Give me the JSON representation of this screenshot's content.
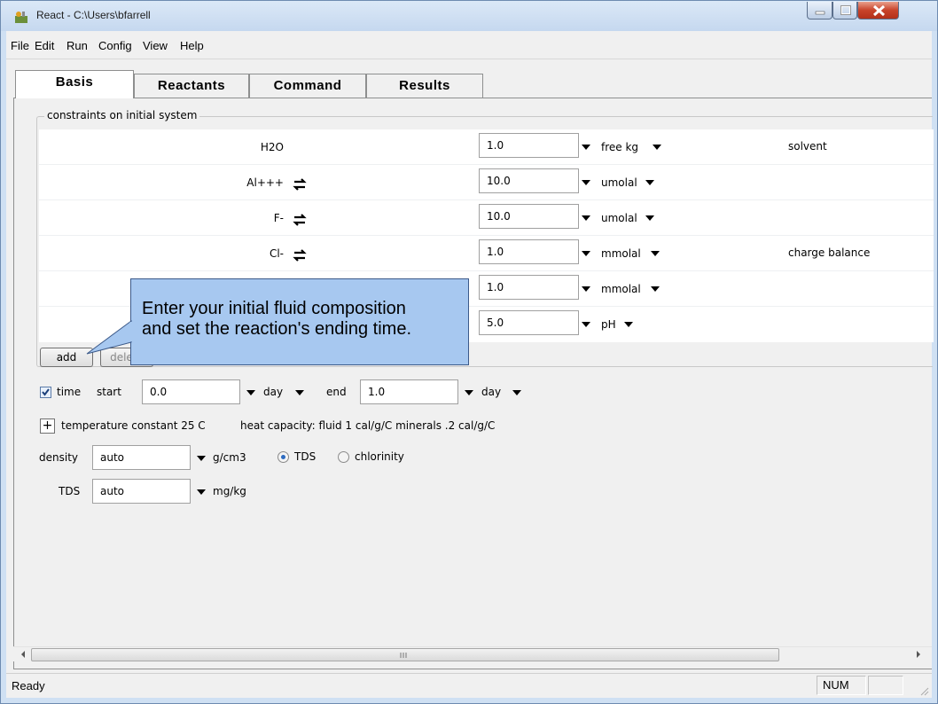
{
  "window": {
    "title": "React - C:\\Users\\bfarrell"
  },
  "menu": [
    {
      "label": "File",
      "name": "menu-file"
    },
    {
      "label": "Edit",
      "name": "menu-edit"
    },
    {
      "label": "Run",
      "name": "menu-run"
    },
    {
      "label": "Config",
      "name": "menu-config"
    },
    {
      "label": "View",
      "name": "menu-view"
    },
    {
      "label": "Help",
      "name": "menu-help"
    }
  ],
  "tabs": [
    {
      "label": "Basis",
      "active": true
    },
    {
      "label": "Reactants",
      "active": false
    },
    {
      "label": "Command",
      "active": false
    },
    {
      "label": "Results",
      "active": false
    }
  ],
  "constraints": {
    "legend": "constraints on initial system",
    "rows": [
      {
        "species": "H2O",
        "swap": false,
        "value": "1.0",
        "unit": "free kg",
        "note": "solvent"
      },
      {
        "species": "Al+++",
        "swap": true,
        "value": "10.0",
        "unit": "umolal",
        "note": ""
      },
      {
        "species": "F-",
        "swap": true,
        "value": "10.0",
        "unit": "umolal",
        "note": ""
      },
      {
        "species": "Cl-",
        "swap": true,
        "value": "1.0",
        "unit": "mmolal",
        "note": "charge balance"
      },
      {
        "species": "",
        "swap": false,
        "value": "1.0",
        "unit": "mmolal",
        "note": ""
      },
      {
        "species": "",
        "swap": false,
        "value": "5.0",
        "unit": "pH",
        "note": ""
      }
    ],
    "add_label": "add",
    "delete_label": "delete"
  },
  "callout": {
    "text": "Enter your initial fluid composition\nand set the reaction's ending time."
  },
  "time": {
    "checked": true,
    "label": "time",
    "start_label": "start",
    "start_value": "0.0",
    "start_unit": "day",
    "end_label": "end",
    "end_value": "1.0",
    "end_unit": "day"
  },
  "temperature": {
    "plus": "+",
    "text": "temperature  constant 25 C",
    "heat_capacity": "heat capacity:  fluid 1 cal/g/C   minerals .2 cal/g/C"
  },
  "density": {
    "label": "density",
    "value": "auto",
    "unit": "g/cm3",
    "radio_tds": "TDS",
    "radio_chlorinity": "chlorinity",
    "selected": "TDS"
  },
  "tds": {
    "label": "TDS",
    "value": "auto",
    "unit": "mg/kg"
  },
  "status": {
    "text": "Ready",
    "num": "NUM"
  },
  "colors": {
    "callout": "#a7c8f0",
    "titlebar": "#cfe0f3",
    "close": "#c8432a"
  },
  "icons": [
    "app-icon",
    "minimize-icon",
    "maximize-icon",
    "close-icon",
    "swap-icon",
    "dropdown-arrow-icon",
    "scroll-left-icon",
    "scroll-right-icon",
    "size-grip-icon"
  ]
}
